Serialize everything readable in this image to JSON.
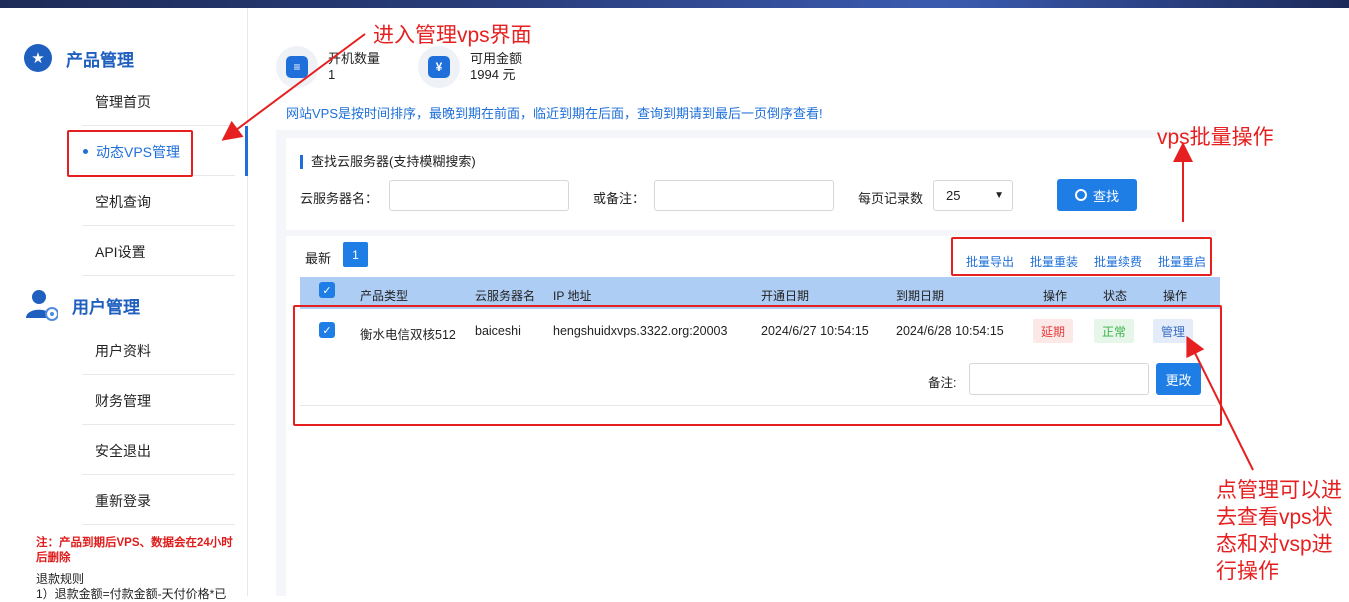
{
  "sidebar": {
    "section1_title": "产品管理",
    "items1": [
      "管理首页",
      "动态VPS管理",
      "空机查询",
      "API设置"
    ],
    "section2_title": "用户管理",
    "items2": [
      "用户资料",
      "财务管理",
      "安全退出",
      "重新登录"
    ],
    "note_red": "注：产品到期后VPS、数据会在24小时后删除",
    "note_black": "退款规则",
    "note_cut": "1）退款金额=付款金额-天付价格*已"
  },
  "stats": {
    "machines_label": "开机数量",
    "machines_value": "1",
    "balance_label": "可用金额",
    "balance_value": "1994 元"
  },
  "notice": "网站VPS是按时间排序，最晚到期在前面，临近到期在后面，查询到期请到最后一页倒序查看!",
  "search": {
    "title": "查找云服务器(支持模糊搜索)",
    "name_label": "云服务器名：",
    "remark_label": "或备注：",
    "per_page_label": "每页记录数",
    "per_page_value": "25",
    "button": "查找"
  },
  "list": {
    "newest": "最新",
    "page": "1",
    "batch_actions": [
      "批量导出",
      "批量重装",
      "批量续费",
      "批量重启"
    ],
    "headers": [
      "产品类型",
      "云服务器名",
      "IP 地址",
      "开通日期",
      "到期日期",
      "操作",
      "状态",
      "操作"
    ],
    "row": {
      "product": "衡水电信双核512",
      "name": "baiceshi",
      "ip": "hengshuidxvps.3322.org:20003",
      "open_date": "2024/6/27 10:54:15",
      "expire_date": "2024/6/28 10:54:15",
      "action_renew": "延期",
      "status": "正常",
      "action_manage": "管理",
      "remark_label": "备注:",
      "change_button": "更改"
    }
  },
  "annotations": {
    "enter_manage": "进入管理vps界面",
    "batch_ops": "vps批量操作",
    "manage_tip_lines": [
      "点管理可以进",
      "去查看vps状",
      "态和对vsp进",
      "行操作"
    ]
  },
  "colors": {
    "accent": "#1e7ee6",
    "annotation_red": "#e62020",
    "table_header": "#aecdf4"
  }
}
